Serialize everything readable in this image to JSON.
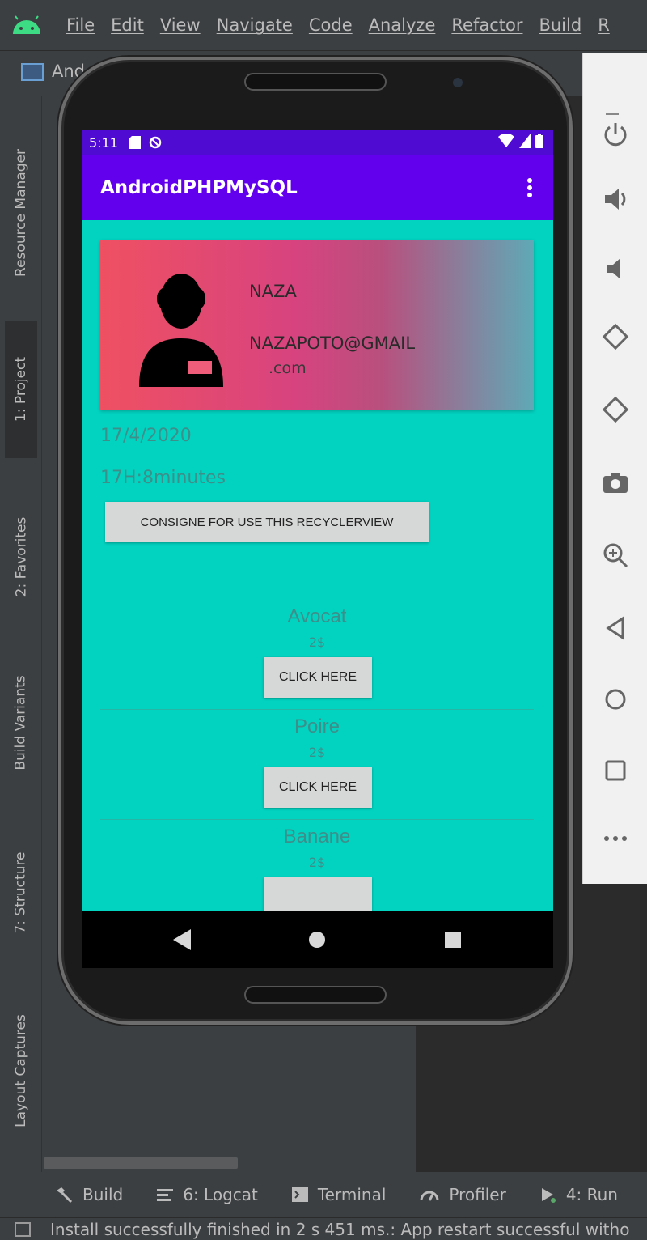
{
  "ide": {
    "menu": [
      "File",
      "Edit",
      "View",
      "Navigate",
      "Code",
      "Analyze",
      "Refactor",
      "Build",
      "R"
    ],
    "project_tab": "And",
    "left_tools": [
      {
        "label": "Resource Manager"
      },
      {
        "label": "1: Project"
      },
      {
        "label": "2: Favorites"
      },
      {
        "label": "Build Variants"
      },
      {
        "label": "7: Structure"
      },
      {
        "label": "Layout Captures"
      }
    ],
    "bottom_tools": [
      {
        "label": "Build"
      },
      {
        "label": "6: Logcat"
      },
      {
        "label": "Terminal"
      },
      {
        "label": "Profiler"
      },
      {
        "label": "4: Run"
      }
    ],
    "status_message": "Install successfully finished in 2 s 451 ms.: App restart successful witho"
  },
  "emulator_panel": {
    "buttons": [
      "power-icon",
      "volume-up-icon",
      "volume-down-icon",
      "rotate-left-icon",
      "rotate-right-icon",
      "camera-icon",
      "zoom-icon",
      "back-icon",
      "home-icon",
      "overview-icon",
      "more-icon"
    ]
  },
  "phone": {
    "status_time": "5:11",
    "app_title": "AndroidPHPMySQL",
    "profile": {
      "name": "NAZA",
      "email_line1": "NAZAPOTO@GMAIL",
      "email_line2": ".com"
    },
    "date": "17/4/2020",
    "time": "17H:8minutes",
    "consigne_button": "CONSIGNE FOR USE THIS RECYCLERVIEW",
    "items": [
      {
        "name": "Avocat",
        "price": "2$",
        "button": "CLICK HERE"
      },
      {
        "name": "Poire",
        "price": "2$",
        "button": "CLICK HERE"
      },
      {
        "name": "Banane",
        "price": "2$",
        "button": ""
      }
    ]
  },
  "colors": {
    "app_bar": "#6200ee",
    "status_bar": "#4f0bd1",
    "content_bg": "#02d3c1"
  }
}
